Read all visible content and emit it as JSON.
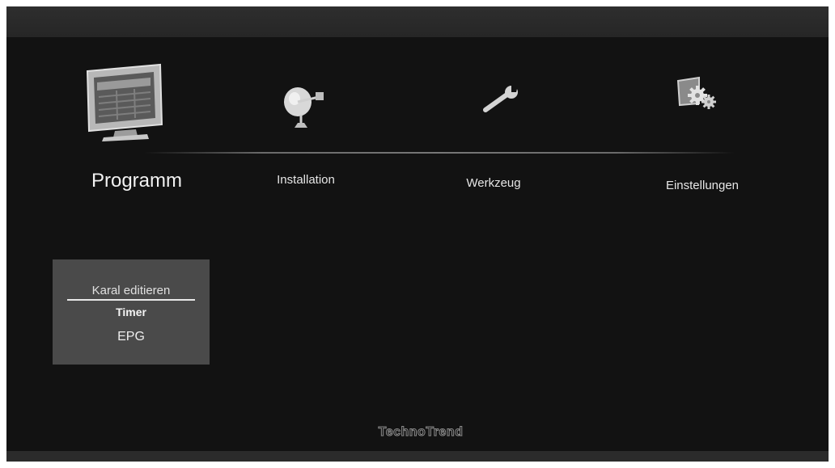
{
  "main_menu": {
    "items": [
      {
        "label": "Programm",
        "icon": "tv-screen-icon",
        "selected": true
      },
      {
        "label": "Installation",
        "icon": "satellite-dish-icon",
        "selected": false
      },
      {
        "label": "Werkzeug",
        "icon": "wrench-icon",
        "selected": false
      },
      {
        "label": "Einstellungen",
        "icon": "settings-gears-icon",
        "selected": false
      }
    ]
  },
  "submenu": {
    "items": [
      {
        "label": "Karal editieren",
        "selected": true
      },
      {
        "label": "Timer",
        "selected": false
      },
      {
        "label": "EPG",
        "selected": false
      }
    ]
  },
  "branding": {
    "logo_text": "TechnoTrend"
  },
  "colors": {
    "background": "#121212",
    "panel": "#4a4a4a",
    "text": "#e6e6e6",
    "bar": "#2b2b2b"
  }
}
